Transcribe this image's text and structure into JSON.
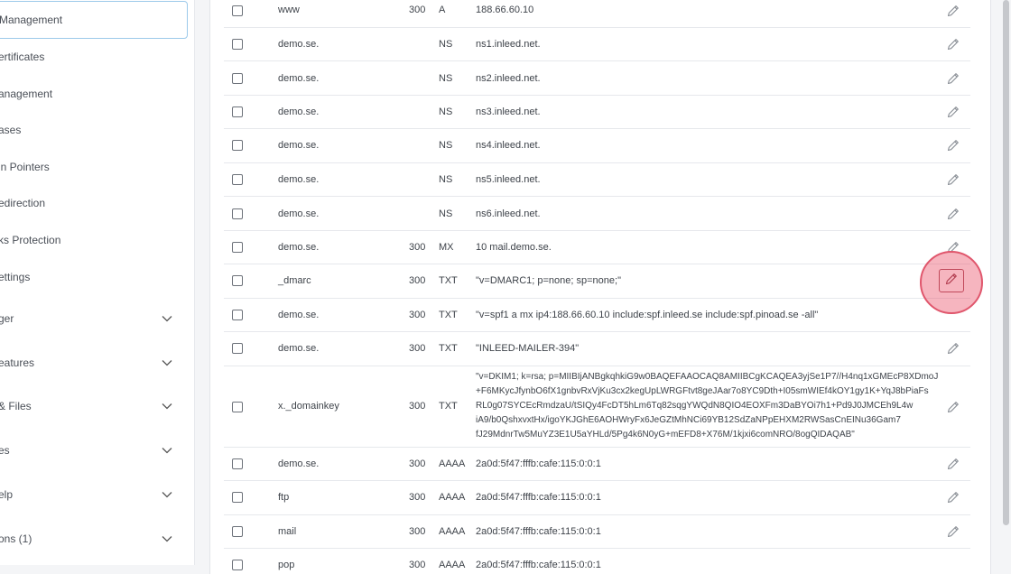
{
  "sidebar": {
    "items": [
      {
        "label": "Management",
        "active": true
      },
      {
        "label": "ertificates"
      },
      {
        "label": "anagement"
      },
      {
        "label": "ases"
      },
      {
        "label": "in Pointers"
      },
      {
        "label": "edirection"
      },
      {
        "label": "ks Protection"
      },
      {
        "label": "ettings"
      },
      {
        "label": "ger",
        "expandable": true
      },
      {
        "label": "eatures",
        "expandable": true
      },
      {
        "label": "& Files",
        "expandable": true
      },
      {
        "label": "es",
        "expandable": true
      },
      {
        "label": "elp",
        "expandable": true
      },
      {
        "label": "ons (1)",
        "expandable": true
      }
    ]
  },
  "records": [
    {
      "name": "www",
      "ttl": "300",
      "type": "A",
      "value": "188.66.60.10"
    },
    {
      "name": "demo.se.",
      "ttl": "",
      "type": "NS",
      "value": "ns1.inleed.net."
    },
    {
      "name": "demo.se.",
      "ttl": "",
      "type": "NS",
      "value": "ns2.inleed.net."
    },
    {
      "name": "demo.se.",
      "ttl": "",
      "type": "NS",
      "value": "ns3.inleed.net."
    },
    {
      "name": "demo.se.",
      "ttl": "",
      "type": "NS",
      "value": "ns4.inleed.net."
    },
    {
      "name": "demo.se.",
      "ttl": "",
      "type": "NS",
      "value": "ns5.inleed.net."
    },
    {
      "name": "demo.se.",
      "ttl": "",
      "type": "NS",
      "value": "ns6.inleed.net."
    },
    {
      "name": "demo.se.",
      "ttl": "300",
      "type": "MX",
      "value": "10 mail.demo.se."
    },
    {
      "name": "_dmarc",
      "ttl": "300",
      "type": "TXT",
      "value": "\"v=DMARC1; p=none; sp=none;\""
    },
    {
      "name": "demo.se.",
      "ttl": "300",
      "type": "TXT",
      "value": "\"v=spf1 a mx ip4:188.66.60.10 include:spf.inleed.se include:spf.pinoad.se -all\""
    },
    {
      "name": "demo.se.",
      "ttl": "300",
      "type": "TXT",
      "value": "\"INLEED-MAILER-394\""
    },
    {
      "name": "x._domainkey",
      "ttl": "300",
      "type": "TXT",
      "value_lines": [
        "\"v=DKIM1; k=rsa; p=MIIBIjANBgkqhkiG9w0BAQEFAAOCAQ8AMIIBCgKCAQEA3yjSe1P7//H4nq1xGMEcP8XDmoJ",
        "+F6MKycJfynbO6fX1gnbvRxVjKu3cx2kegUpLWRGFtvt8geJAar7o8YC9Dth+I05smWIEf4kOY1gy1K+YqJ8bPiaFs",
        "RL0g07SYCEcRmdzaU/tSIQy4FcDT5hLm6Tq82sqgYWQdN8QIO4EOXFm3DaBYOi7h1+Pd9J0JMCEh9L4w",
        "iA9/b0QshxvxtHx/igoYKJGhE6AOHWryFx6JeGZtMhNCi69YB12SdZaNPpEHXM2RWSasCnEINu36Gam7",
        "fJ29MdnrTw5MuYZ3E1U5aYHLd/5Pg4k6N0yG+mEFD8+X76M/1kjxi6comNRO/8ogQIDAQAB\""
      ]
    },
    {
      "name": "demo.se.",
      "ttl": "300",
      "type": "AAAA",
      "value": "2a0d:5f47:fffb:cafe:115:0:0:1"
    },
    {
      "name": "ftp",
      "ttl": "300",
      "type": "AAAA",
      "value": "2a0d:5f47:fffb:cafe:115:0:0:1"
    },
    {
      "name": "mail",
      "ttl": "300",
      "type": "AAAA",
      "value": "2a0d:5f47:fffb:cafe:115:0:0:1"
    },
    {
      "name": "pop",
      "ttl": "300",
      "type": "AAAA",
      "value": "2a0d:5f47:fffb:cafe:115:0:0:1"
    }
  ],
  "icons": {
    "edit": "pencil-icon",
    "expand": "chevron-down-icon"
  },
  "colors": {
    "highlight": "#e0566c",
    "active_border": "#9cc9ea"
  }
}
